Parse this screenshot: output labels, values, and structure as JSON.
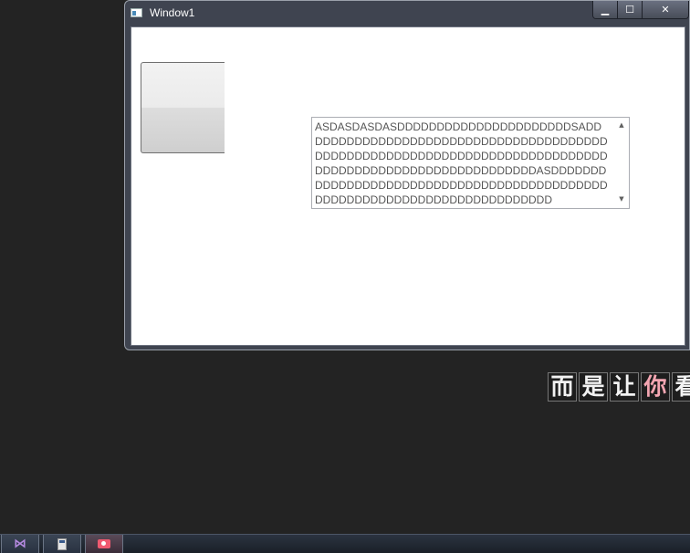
{
  "window": {
    "title": "Window1",
    "controls": {
      "minimize": "▁",
      "maximize": "☐",
      "close": "✕"
    }
  },
  "content": {
    "button_label": "",
    "textbox_value": "ASDASDASDASDDDDDDDDDDDDDDDDDDDDDDSADDDDDDDDDDDDDDDDDDDDDDDDDDDDDDDDDDDDDDDDDDDDDDDDDDDDDDDDDDDDDDDDDDDDDDDDDDDDDDDDDDDDDDDDDDDDDDDDDDDDDDDDASDDDDDDDDDDDDDDDDDDDDDDDDDDDDDDDDDDDDDDDDDDDDDDDDDDDDDDDDDDDDDDDDDDDDDDDDDD",
    "scroll_up": "▲",
    "scroll_down": "▼"
  },
  "background": {
    "line2_chars": [
      "而",
      "是",
      "让",
      "你",
      "看"
    ]
  },
  "taskbar": {
    "apps": [
      {
        "name": "visual-studio",
        "icon": "vs-icon"
      },
      {
        "name": "calculator",
        "icon": "calculator-icon"
      },
      {
        "name": "screen-recorder",
        "icon": "camera-icon"
      }
    ]
  },
  "colors": {
    "desktop": "#232323",
    "window_frame": "#3f4450",
    "client_bg": "#ffffff",
    "textbox_border": "#abadb3",
    "highlight_char": "#f4a6b2"
  }
}
